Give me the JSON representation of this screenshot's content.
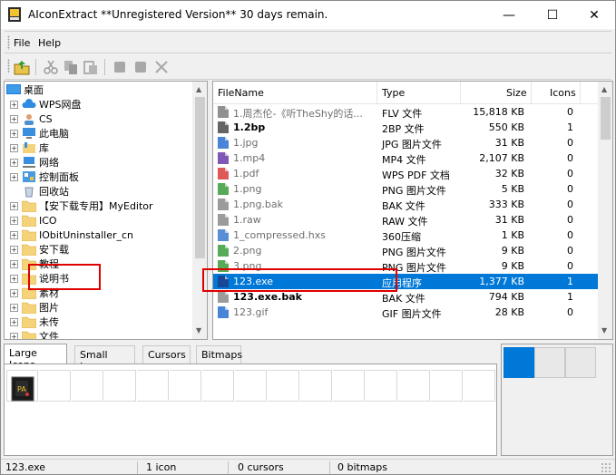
{
  "window": {
    "title": "AIconExtract  **Unregistered Version** 30 days remain.",
    "minimize_glyph": "—",
    "maximize_glyph": "☐",
    "close_glyph": "✕"
  },
  "menu": [
    "File",
    "Help"
  ],
  "toolbar": {
    "icons": [
      "open-folder-icon",
      "cut-icon",
      "copy-icon",
      "paste-icon",
      "stop-icon",
      "square-icon",
      "delete-icon"
    ]
  },
  "tree": {
    "root": "桌面",
    "items": [
      {
        "label": "WPS网盘",
        "icon": "cloud-icon"
      },
      {
        "label": "CS",
        "icon": "user-icon"
      },
      {
        "label": "此电脑",
        "icon": "computer-icon"
      },
      {
        "label": "库",
        "icon": "library-icon"
      },
      {
        "label": "网络",
        "icon": "network-icon"
      },
      {
        "label": "控制面板",
        "icon": "control-panel-icon"
      },
      {
        "label": "回收站",
        "icon": "recycle-bin-icon"
      },
      {
        "label": "【安下载专用】MyEditor",
        "icon": "folder-icon"
      },
      {
        "label": "ICO",
        "icon": "folder-icon"
      },
      {
        "label": "IObitUninstaller_cn",
        "icon": "folder-icon"
      },
      {
        "label": "安下载",
        "icon": "folder-icon"
      },
      {
        "label": "教程",
        "icon": "folder-icon"
      },
      {
        "label": "说明书",
        "icon": "folder-icon"
      },
      {
        "label": "素材",
        "icon": "folder-icon"
      },
      {
        "label": "图片",
        "icon": "folder-icon"
      },
      {
        "label": "未传",
        "icon": "folder-icon"
      },
      {
        "label": "文件",
        "icon": "folder-icon"
      }
    ]
  },
  "filelist": {
    "columns": [
      "FileName",
      "Type",
      "Size",
      "Icons"
    ],
    "rows": [
      {
        "name": "1.周杰伦-《听TheShy的话...",
        "type": "FLV 文件",
        "size": "15,818 KB",
        "icons": "0",
        "bold": false,
        "color": "#7c7c7c"
      },
      {
        "name": "1.2bp",
        "type": "2BP 文件",
        "size": "550 KB",
        "icons": "1",
        "bold": true,
        "color": "#4a4a4a"
      },
      {
        "name": "1.jpg",
        "type": "JPG 图片文件",
        "size": "31 KB",
        "icons": "0",
        "bold": false,
        "color": "#2a6fcf"
      },
      {
        "name": "1.mp4",
        "type": "MP4 文件",
        "size": "2,107 KB",
        "icons": "0",
        "bold": false,
        "color": "#6a3aa8"
      },
      {
        "name": "1.pdf",
        "type": "WPS PDF 文档",
        "size": "32 KB",
        "icons": "0",
        "bold": false,
        "color": "#d83b3b"
      },
      {
        "name": "1.png",
        "type": "PNG 图片文件",
        "size": "5 KB",
        "icons": "0",
        "bold": false,
        "color": "#3a9b3a"
      },
      {
        "name": "1.png.bak",
        "type": "BAK 文件",
        "size": "333 KB",
        "icons": "0",
        "bold": false,
        "color": "#8a8a8a"
      },
      {
        "name": "1.raw",
        "type": "RAW 文件",
        "size": "31 KB",
        "icons": "0",
        "bold": false,
        "color": "#8a8a8a"
      },
      {
        "name": "1_compressed.hxs",
        "type": "360压缩",
        "size": "1 KB",
        "icons": "0",
        "bold": false,
        "color": "#3a7acf"
      },
      {
        "name": "2.png",
        "type": "PNG 图片文件",
        "size": "9 KB",
        "icons": "0",
        "bold": false,
        "color": "#3a9b3a"
      },
      {
        "name": "3.png",
        "type": "PNG 图片文件",
        "size": "9 KB",
        "icons": "0",
        "bold": false,
        "color": "#3a9b3a"
      },
      {
        "name": "123.exe",
        "type": "应用程序",
        "size": "1,377 KB",
        "icons": "1",
        "bold": false,
        "color": "#1d3d8a",
        "selected": true
      },
      {
        "name": "123.exe.bak",
        "type": "BAK 文件",
        "size": "794 KB",
        "icons": "1",
        "bold": true,
        "color": "#8a8a8a"
      },
      {
        "name": "123.gif",
        "type": "GIF 图片文件",
        "size": "28 KB",
        "icons": "0",
        "bold": false,
        "color": "#2a6fcf"
      }
    ]
  },
  "tabs": [
    "Large Icons",
    "Small Icons",
    "Cursors",
    "Bitmaps"
  ],
  "status": {
    "file": "123.exe",
    "icons": "1 icon",
    "cursors": "0 cursors",
    "bitmaps": "0 bitmaps"
  },
  "colors": {
    "selection": "#0078d7",
    "folder": "#f5d37a",
    "annotation": "#e00000"
  }
}
